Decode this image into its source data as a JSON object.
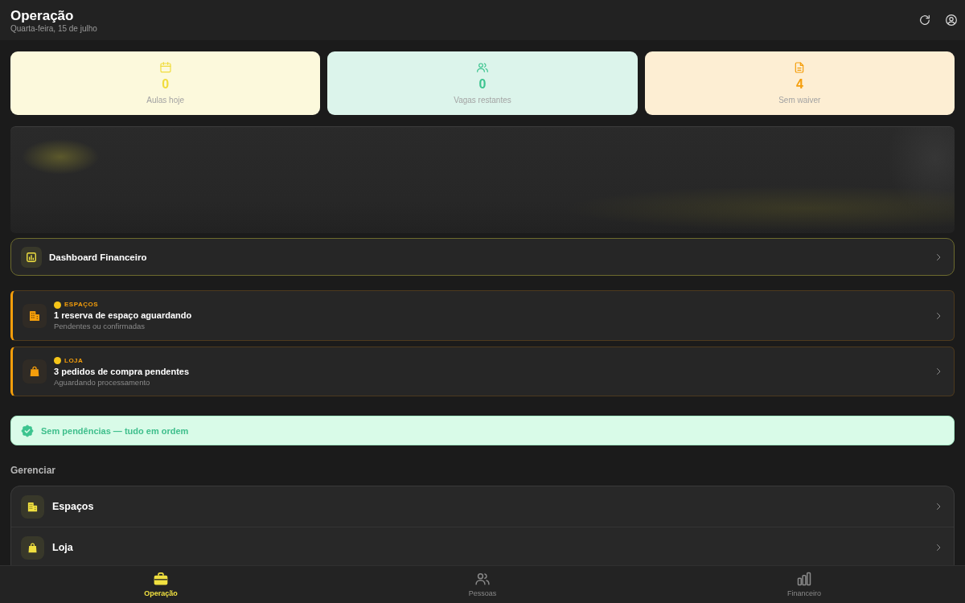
{
  "header": {
    "title": "Operação",
    "subtitle": "Quarta-feira, 15 de julho"
  },
  "stats": [
    {
      "value": "0",
      "label": "Aulas hoje",
      "color": "#f0dc3c"
    },
    {
      "value": "0",
      "label": "Vagas restantes",
      "color": "#3cc48f"
    },
    {
      "value": "4",
      "label": "Sem waiver",
      "color": "#f59e0b"
    }
  ],
  "dashboard_link": {
    "label": "Dashboard Financeiro"
  },
  "alerts": [
    {
      "tag": "ESPAÇOS",
      "title": "1 reserva de espaço aguardando",
      "subtitle": "Pendentes ou confirmadas"
    },
    {
      "tag": "LOJA",
      "title": "3 pedidos de compra pendentes",
      "subtitle": "Aguardando processamento"
    }
  ],
  "status_banner": {
    "text": "Sem pendências — tudo em ordem"
  },
  "manage": {
    "heading": "Gerenciar",
    "items": [
      {
        "label": "Espaços"
      },
      {
        "label": "Loja"
      }
    ]
  },
  "bottom_nav": [
    {
      "label": "Operação",
      "selected": true
    },
    {
      "label": "Pessoas",
      "selected": false
    },
    {
      "label": "Financeiro",
      "selected": false
    }
  ]
}
